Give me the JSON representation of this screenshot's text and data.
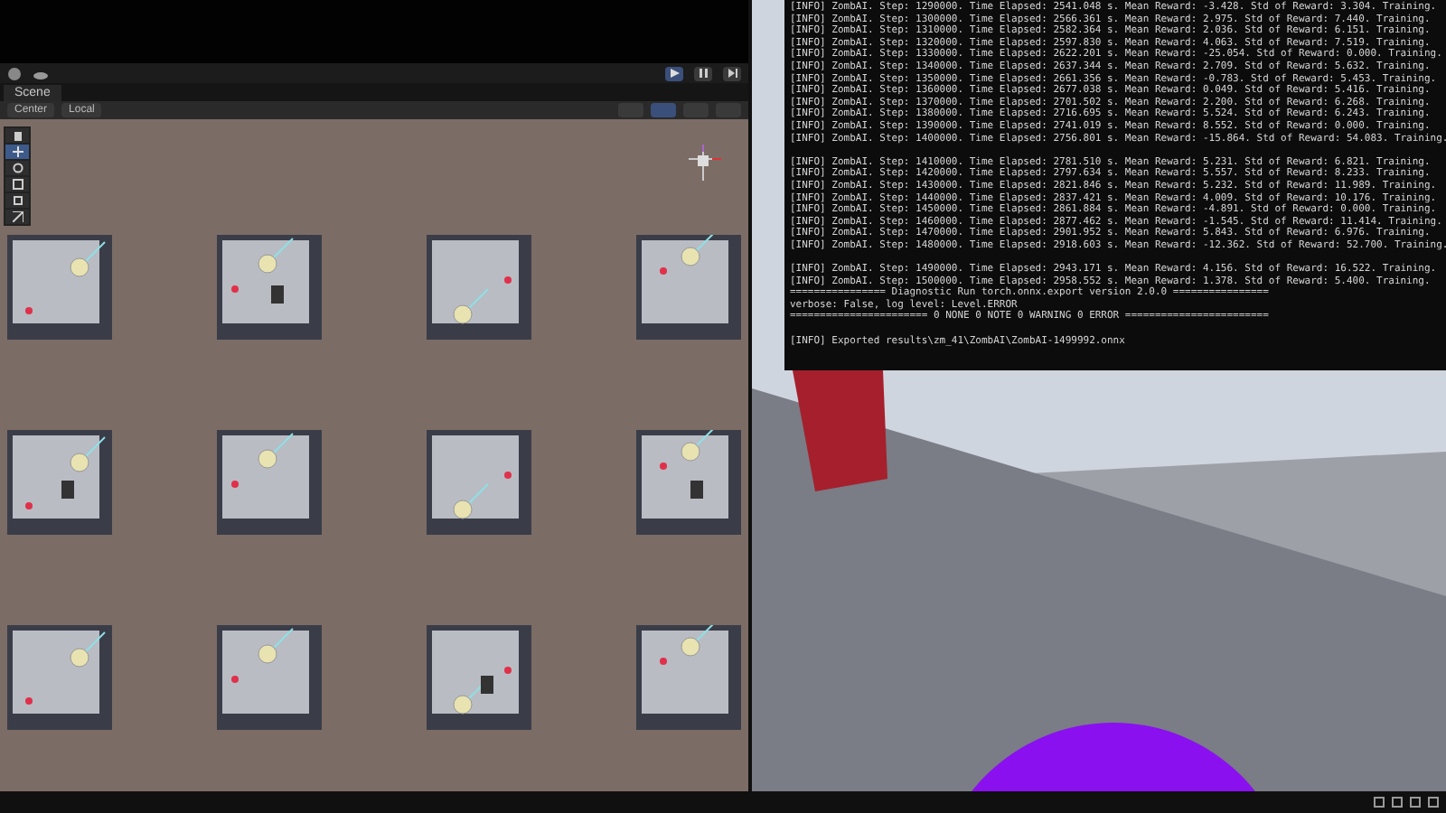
{
  "editor": {
    "scene_tab": "Scene",
    "pivot": "Center",
    "space": "Local",
    "playing": true,
    "tools": [
      {
        "kind": "hand",
        "selected": false
      },
      {
        "kind": "move",
        "selected": true
      },
      {
        "kind": "rotate",
        "selected": false
      },
      {
        "kind": "scale",
        "selected": false
      },
      {
        "kind": "rect",
        "selected": false
      },
      {
        "kind": "transform",
        "selected": false
      }
    ]
  },
  "console": {
    "blocks": [
      [
        "[INFO] ZombAI. Step: 1290000. Time Elapsed: 2541.048 s. Mean Reward: -3.428. Std of Reward: 3.304. Training.",
        "[INFO] ZombAI. Step: 1300000. Time Elapsed: 2566.361 s. Mean Reward: 2.975. Std of Reward: 7.440. Training.",
        "[INFO] ZombAI. Step: 1310000. Time Elapsed: 2582.364 s. Mean Reward: 2.036. Std of Reward: 6.151. Training.",
        "[INFO] ZombAI. Step: 1320000. Time Elapsed: 2597.830 s. Mean Reward: 4.063. Std of Reward: 7.519. Training.",
        "[INFO] ZombAI. Step: 1330000. Time Elapsed: 2622.201 s. Mean Reward: -25.054. Std of Reward: 0.000. Training.",
        "[INFO] ZombAI. Step: 1340000. Time Elapsed: 2637.344 s. Mean Reward: 2.709. Std of Reward: 5.632. Training.",
        "[INFO] ZombAI. Step: 1350000. Time Elapsed: 2661.356 s. Mean Reward: -0.783. Std of Reward: 5.453. Training.",
        "[INFO] ZombAI. Step: 1360000. Time Elapsed: 2677.038 s. Mean Reward: 0.049. Std of Reward: 5.416. Training.",
        "[INFO] ZombAI. Step: 1370000. Time Elapsed: 2701.502 s. Mean Reward: 2.200. Std of Reward: 6.268. Training.",
        "[INFO] ZombAI. Step: 1380000. Time Elapsed: 2716.695 s. Mean Reward: 5.524. Std of Reward: 6.243. Training.",
        "[INFO] ZombAI. Step: 1390000. Time Elapsed: 2741.019 s. Mean Reward: 8.552. Std of Reward: 0.000. Training.",
        "[INFO] ZombAI. Step: 1400000. Time Elapsed: 2756.801 s. Mean Reward: -15.864. Std of Reward: 54.083. Training."
      ],
      [
        "[INFO] ZombAI. Step: 1410000. Time Elapsed: 2781.510 s. Mean Reward: 5.231. Std of Reward: 6.821. Training.",
        "[INFO] ZombAI. Step: 1420000. Time Elapsed: 2797.634 s. Mean Reward: 5.557. Std of Reward: 8.233. Training.",
        "[INFO] ZombAI. Step: 1430000. Time Elapsed: 2821.846 s. Mean Reward: 5.232. Std of Reward: 11.989. Training.",
        "[INFO] ZombAI. Step: 1440000. Time Elapsed: 2837.421 s. Mean Reward: 4.009. Std of Reward: 10.176. Training.",
        "[INFO] ZombAI. Step: 1450000. Time Elapsed: 2861.884 s. Mean Reward: -4.891. Std of Reward: 0.000. Training.",
        "[INFO] ZombAI. Step: 1460000. Time Elapsed: 2877.462 s. Mean Reward: -1.545. Std of Reward: 11.414. Training.",
        "[INFO] ZombAI. Step: 1470000. Time Elapsed: 2901.952 s. Mean Reward: 5.843. Std of Reward: 6.976. Training.",
        "[INFO] ZombAI. Step: 1480000. Time Elapsed: 2918.603 s. Mean Reward: -12.362. Std of Reward: 52.700. Training."
      ],
      [
        "[INFO] ZombAI. Step: 1490000. Time Elapsed: 2943.171 s. Mean Reward: 4.156. Std of Reward: 16.522. Training.",
        "[INFO] ZombAI. Step: 1500000. Time Elapsed: 2958.552 s. Mean Reward: 1.378. Std of Reward: 5.400. Training.",
        "================ Diagnostic Run torch.onnx.export version 2.0.0 ================",
        "verbose: False, log level: Level.ERROR",
        "======================= 0 NONE 0 NOTE 0 WARNING 0 ERROR ========================"
      ],
      [
        "[INFO] Exported results\\zm_41\\ZombAI\\ZombAI-1499992.onnx"
      ]
    ]
  }
}
